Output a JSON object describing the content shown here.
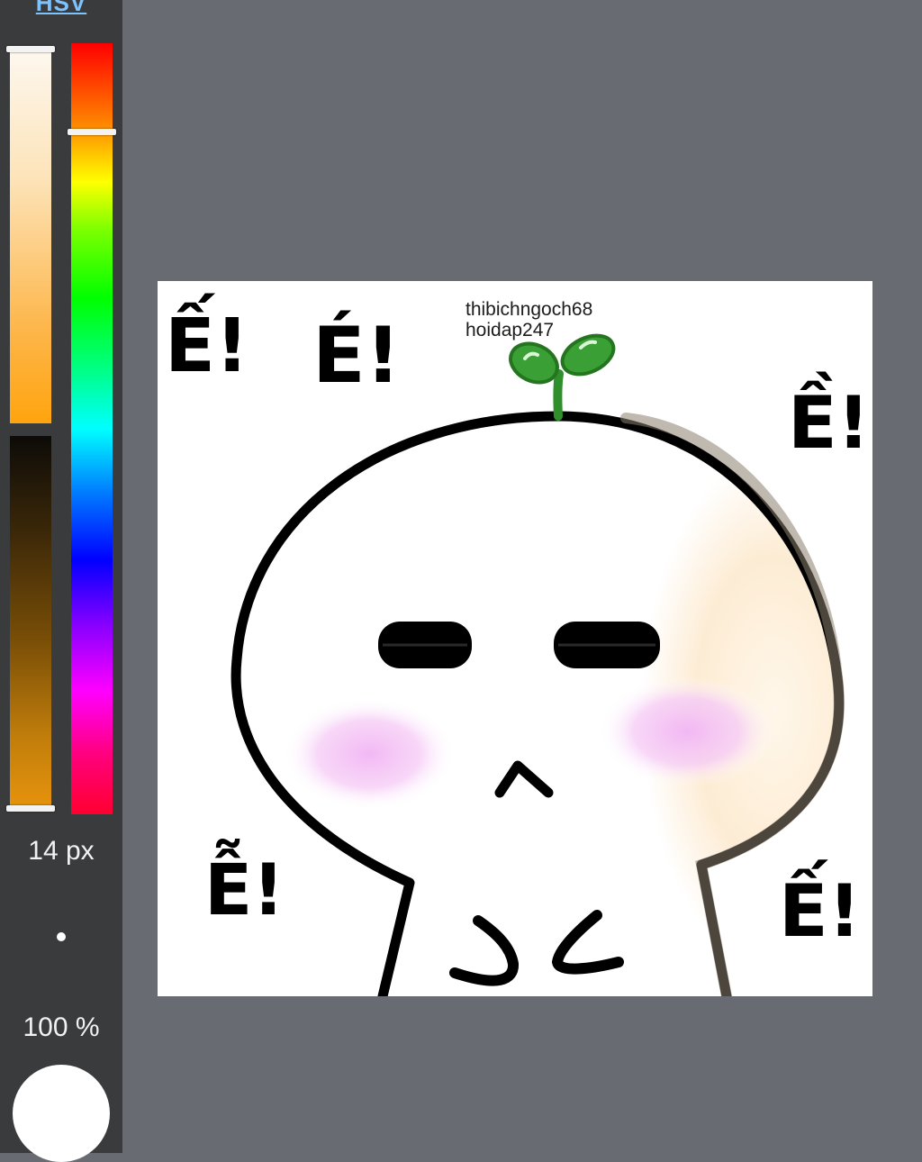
{
  "color_panel": {
    "mode_label": "HSV",
    "brush_size": "14 px",
    "opacity": "100 %",
    "current_color": "#ffffff"
  },
  "canvas": {
    "watermark": {
      "line1": "thibichngoch68",
      "line2": "hoidap247"
    },
    "texts": {
      "e1": "Ế!",
      "e2": "É!",
      "e3": "Ề!",
      "e4": "Ễ!",
      "e5": "Ế!"
    }
  }
}
